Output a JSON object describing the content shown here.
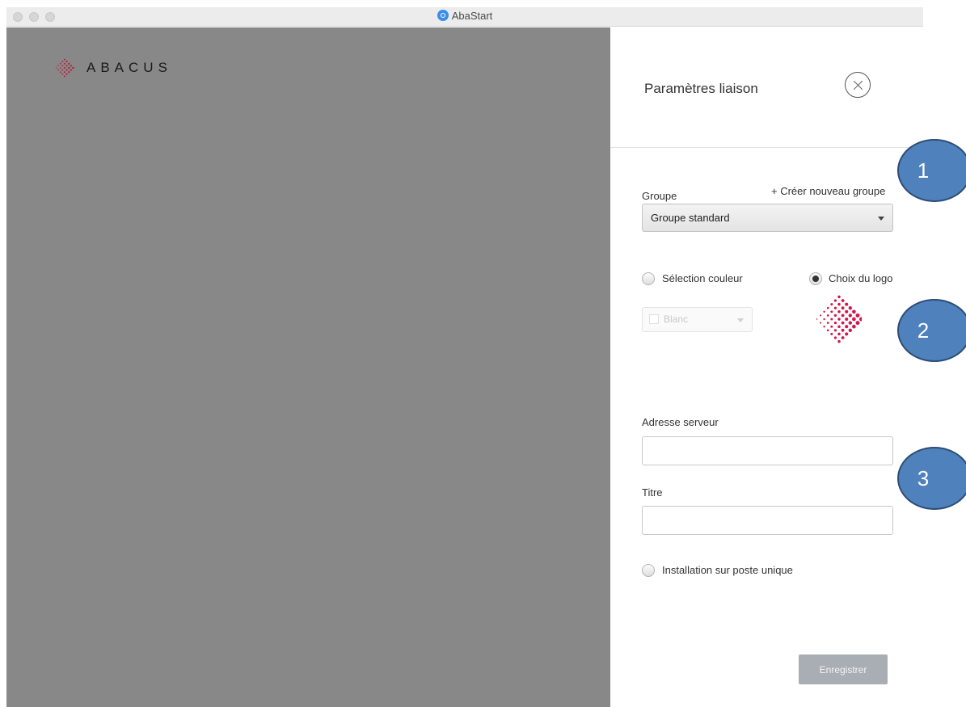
{
  "window": {
    "title": "AbaStart"
  },
  "brand": {
    "name": "ABACUS"
  },
  "panel": {
    "title": "Paramètres liaison",
    "group_label": "Groupe",
    "create_group_link": "+ Créer nouveau groupe",
    "group_selected": "Groupe standard",
    "color_radio_label": "Sélection couleur",
    "logo_radio_label": "Choix du logo",
    "color_selected": "Blanc",
    "server_address_label": "Adresse serveur",
    "server_address_value": "",
    "title_label": "Titre",
    "title_value": "",
    "single_install_label": "Installation sur poste unique",
    "save_button": "Enregistrer"
  },
  "callouts": [
    "1",
    "2",
    "3"
  ],
  "colors": {
    "left_pane": "#888888",
    "logo_red": "#d3164a",
    "callout_fill": "#4f81bd",
    "save_button": "#a9aeb4"
  }
}
